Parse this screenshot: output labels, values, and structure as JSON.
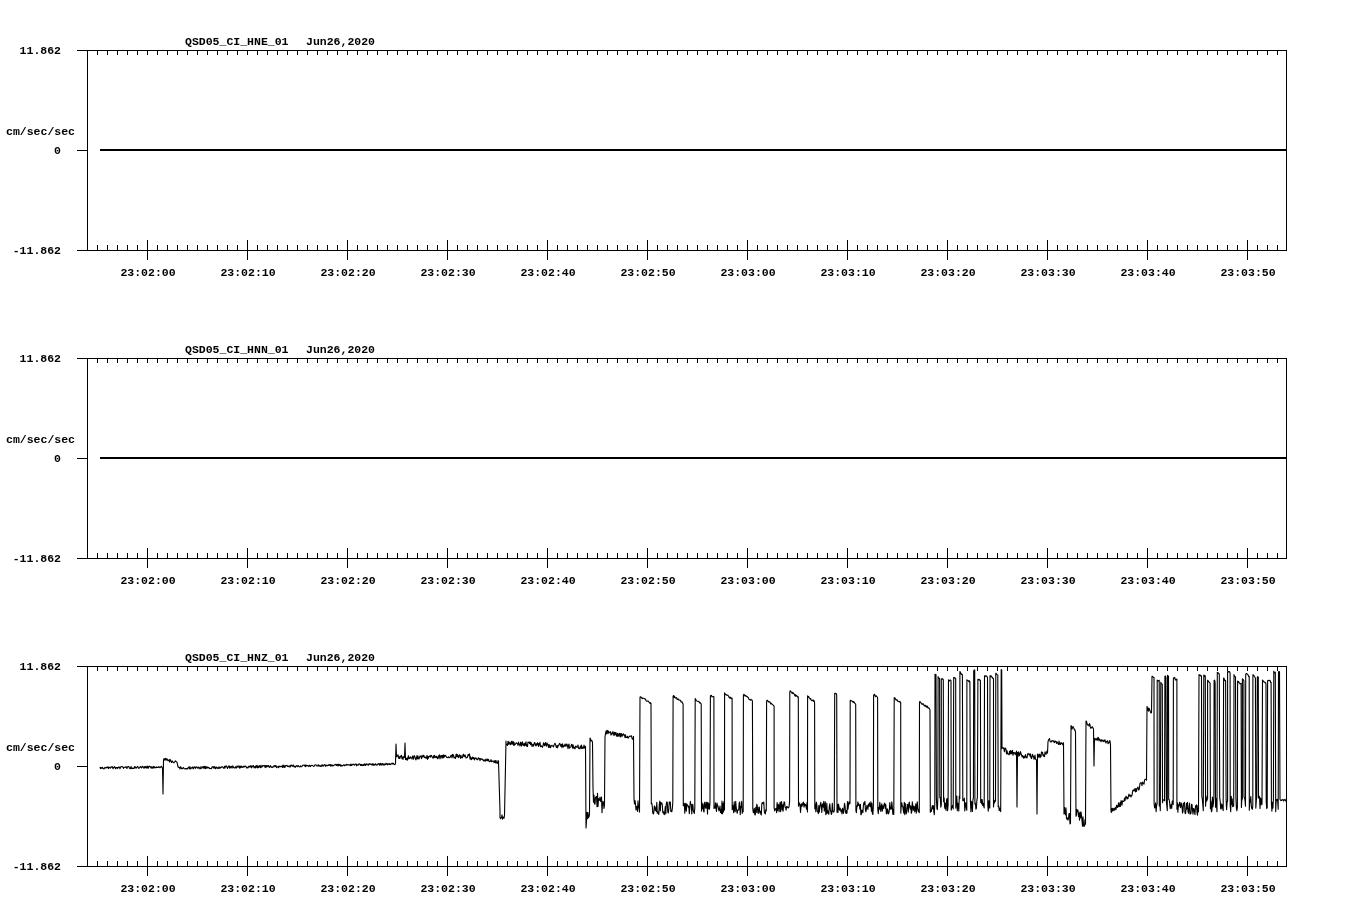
{
  "panels": [
    {
      "station": "QSD05_CI_HNE_01",
      "date": "Jun26,2020",
      "ylabel": "cm/sec/sec",
      "yticks": [
        "11.862",
        "0",
        "-11.862"
      ],
      "xticks": [
        "23:02:00",
        "23:02:10",
        "23:02:20",
        "23:02:30",
        "23:02:40",
        "23:02:50",
        "23:03:00",
        "23:03:10",
        "23:03:20",
        "23:03:30",
        "23:03:40",
        "23:03:50"
      ],
      "kind": "flat"
    },
    {
      "station": "QSD05_CI_HNN_01",
      "date": "Jun26,2020",
      "ylabel": "cm/sec/sec",
      "yticks": [
        "11.862",
        "0",
        "-11.862"
      ],
      "xticks": [
        "23:02:00",
        "23:02:10",
        "23:02:20",
        "23:02:30",
        "23:02:40",
        "23:02:50",
        "23:03:00",
        "23:03:10",
        "23:03:20",
        "23:03:30",
        "23:03:40",
        "23:03:50"
      ],
      "kind": "flat"
    },
    {
      "station": "QSD05_CI_HNZ_01",
      "date": "Jun26,2020",
      "ylabel": "cm/sec/sec",
      "yticks": [
        "11.862",
        "0",
        "-11.862"
      ],
      "xticks": [
        "23:02:00",
        "23:02:10",
        "23:02:20",
        "23:02:30",
        "23:02:40",
        "23:02:50",
        "23:03:00",
        "23:03:10",
        "23:03:20",
        "23:03:30",
        "23:03:40",
        "23:03:50"
      ],
      "kind": "waveform"
    }
  ]
}
